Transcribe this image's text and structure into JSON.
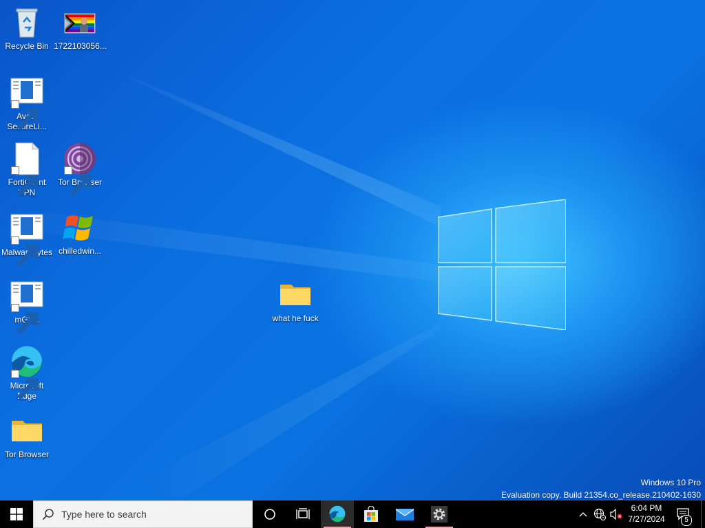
{
  "desktop": {
    "icons": [
      {
        "label": "Recycle Bin",
        "icon": "recycle-bin-icon"
      },
      {
        "label": "1722103056...",
        "icon": "image-file-icon"
      },
      {
        "label": "Avast SecureLi...",
        "icon": "app-shortcut-icon"
      },
      {
        "label": "FortiClient VPN",
        "icon": "blank-file-icon"
      },
      {
        "label": "Tor Browser",
        "icon": "tor-browser-icon"
      },
      {
        "label": "Malwarebytes",
        "icon": "app-shortcut-icon"
      },
      {
        "label": "chilledwin...",
        "icon": "windows-xp-logo-icon"
      },
      {
        "label": "mGBA",
        "icon": "app-shortcut-icon"
      },
      {
        "label": "Microsoft Edge",
        "icon": "edge-icon"
      },
      {
        "label": "Tor Browser",
        "icon": "folder-icon"
      },
      {
        "label": "what he fuck",
        "icon": "folder-icon"
      }
    ],
    "watermark": {
      "line1": "Windows 10 Pro",
      "line2": "Evaluation copy. Build 21354.co_release.210402-1630"
    }
  },
  "taskbar": {
    "search_placeholder": "Type here to search",
    "apps": [
      "cortana",
      "task-view",
      "microsoft-edge",
      "microsoft-store",
      "mail",
      "settings"
    ],
    "clock": {
      "time": "6:04 PM",
      "date": "7/27/2024"
    },
    "notifications_count": "5"
  },
  "colors": {
    "accent": "#0078d7",
    "taskbar": "#000000",
    "active_indicator": "#f2a0a8"
  }
}
